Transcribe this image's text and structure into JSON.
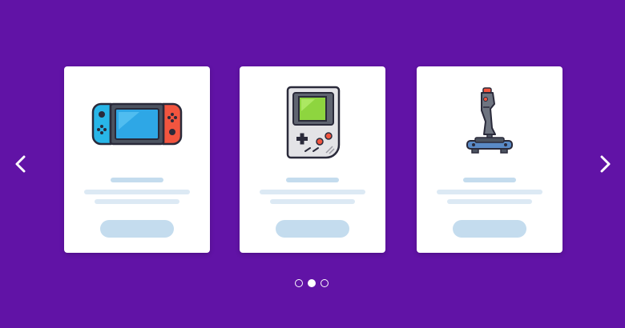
{
  "carousel": {
    "cards": [
      {
        "icon": "handheld-console-icon"
      },
      {
        "icon": "retro-handheld-icon"
      },
      {
        "icon": "joystick-icon"
      }
    ],
    "pagination": {
      "total": 3,
      "active_index": 1
    }
  },
  "colors": {
    "background": "#6113a6",
    "card": "#ffffff",
    "placeholder_dark": "#c4dcee",
    "placeholder_light": "#dce9f4"
  }
}
